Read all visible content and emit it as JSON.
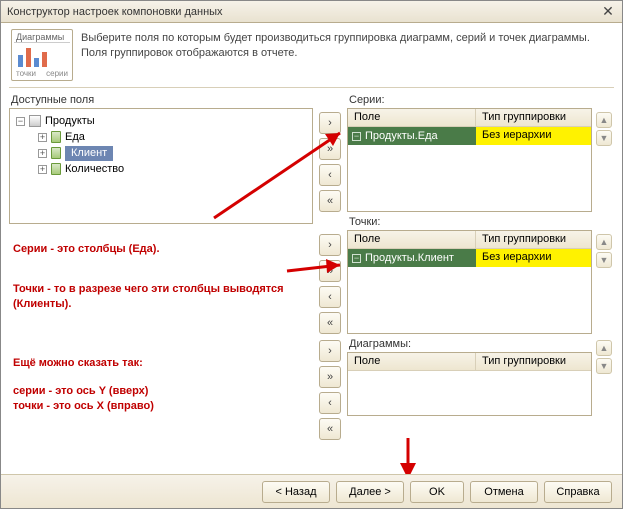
{
  "window": {
    "title": "Конструктор настроек компоновки данных"
  },
  "thumb": {
    "tab": "Диаграммы",
    "axis_left": "точки",
    "axis_right": "серии"
  },
  "hint": {
    "line1": "Выберите поля по которым будет производиться группировка диаграмм, серий и точек диаграммы.",
    "line2": "Поля группировок отображаются в отчете."
  },
  "available": {
    "label": "Доступные поля",
    "root": "Продукты",
    "items": [
      "Еда",
      "Клиент",
      "Количество"
    ]
  },
  "grids": {
    "col_field": "Поле",
    "col_group": "Тип группировки"
  },
  "series": {
    "label": "Серии:",
    "row_field": "Продукты.Еда",
    "row_group": "Без иерархии"
  },
  "points": {
    "label": "Точки:",
    "row_field": "Продукты.Клиент",
    "row_group": "Без иерархии"
  },
  "diagrams": {
    "label": "Диаграммы:"
  },
  "annotations": {
    "a1": "Серии - это столбцы (Еда).",
    "a2": "Точки - то в разрезе чего эти столбцы выводятся (Клиенты).",
    "a3": "Ещё можно сказать так:",
    "a4_l1": "серии - это ось Y (вверх)",
    "a4_l2": "точки - это ось X (вправо)"
  },
  "footer": {
    "back": "< Назад",
    "next": "Далее >",
    "ok": "OK",
    "cancel": "Отмена",
    "help": "Справка"
  }
}
